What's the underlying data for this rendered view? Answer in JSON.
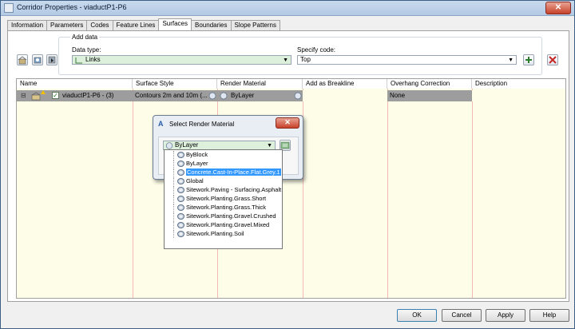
{
  "window": {
    "title": "Corridor Properties - viaductP1-P6",
    "close_label": "✕"
  },
  "tabs": [
    "Information",
    "Parameters",
    "Codes",
    "Feature Lines",
    "Surfaces",
    "Boundaries",
    "Slope Patterns"
  ],
  "active_tab": "Surfaces",
  "add_data": {
    "legend": "Add data",
    "data_type_label": "Data type:",
    "data_type_value": "Links",
    "specify_code_label": "Specify code:",
    "specify_code_value": "Top"
  },
  "grid": {
    "columns": [
      "Name",
      "Surface Style",
      "Render Material",
      "Add as Breakline",
      "Overhang Correction",
      "Description"
    ],
    "row": {
      "name": "viaductP1-P6 - (3)",
      "surface_style": "Contours 2m and 10m (...",
      "render_material": "ByLayer",
      "add_as_breakline": "",
      "overhang_correction": "None",
      "description": ""
    }
  },
  "dialog": {
    "title": "Select Render Material",
    "close_label": "✕",
    "selected_value": "ByLayer",
    "options": [
      "ByBlock",
      "ByLayer",
      "Concrete.Cast-In-Place.Flat.Grey.1",
      "Global",
      "Sitework.Paving - Surfacing.Asphalt",
      "Sitework.Planting.Grass.Short",
      "Sitework.Planting.Grass.Thick",
      "Sitework.Planting.Gravel.Crushed",
      "Sitework.Planting.Gravel.Mixed",
      "Sitework.Planting.Soil"
    ],
    "highlighted_option": "Concrete.Cast-In-Place.Flat.Grey.1"
  },
  "buttons": {
    "ok": "OK",
    "cancel": "Cancel",
    "apply": "Apply",
    "help": "Help"
  },
  "colors": {
    "highlight": "#3399ff",
    "row_selected": "#9d9d9d",
    "grid_bg": "#fdfde8"
  }
}
